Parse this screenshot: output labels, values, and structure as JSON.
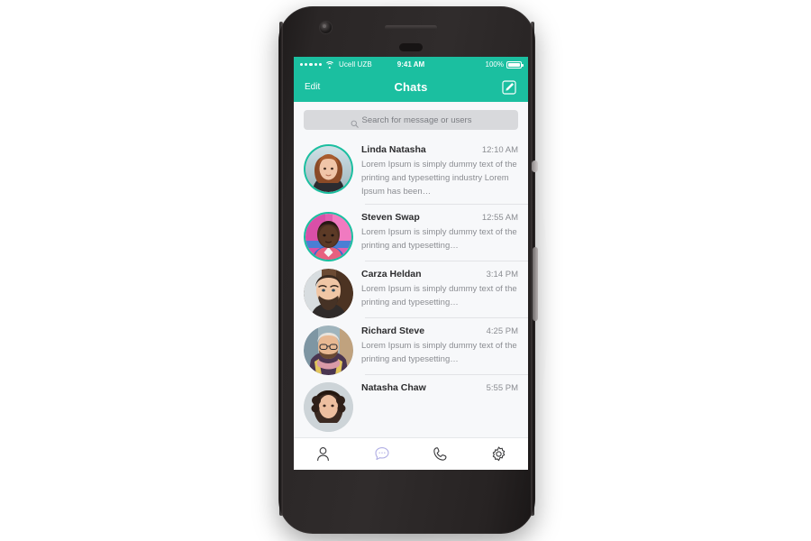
{
  "device": {
    "label": "smartphone-mockup",
    "camera_icon": "camera-icon",
    "speaker_icon": "speaker-grille",
    "sensor_icon": "proximity-sensor",
    "power_button": "power-button",
    "volume_button": "volume-button"
  },
  "theme": {
    "accent": "#1BBFA0",
    "screen_bg": "#F7F8FA",
    "tab_active": "#B0AEE4",
    "tab_inactive": "#3A3A3C",
    "name_color": "#2C2C2E",
    "muted_color": "#8B8D92",
    "divider": "#E2E3E6",
    "search_bg": "#D8D9DC"
  },
  "status_bar": {
    "signal_icon": "signal-dots-icon",
    "signal_bars": 5,
    "wifi_icon": "wifi-icon",
    "carrier": "Ucell UZB",
    "time": "9:41 AM",
    "battery_percent": "100%",
    "battery_icon": "battery-full-icon"
  },
  "nav_bar": {
    "edit_label": "Edit",
    "title": "Chats",
    "compose_icon": "compose-icon"
  },
  "search": {
    "icon": "search-icon",
    "placeholder": "Search for message or users",
    "value": ""
  },
  "chats": [
    {
      "name": "Linda Natasha",
      "time": "12:10 AM",
      "preview": "Lorem Ipsum is simply dummy text of the printing and typesetting industry Lorem Ipsum has been…",
      "avatar": "avatar-linda-natasha",
      "ring": true
    },
    {
      "name": "Steven Swap",
      "time": "12:55 AM",
      "preview": "Lorem Ipsum is simply dummy text of the printing and typesetting…",
      "avatar": "avatar-steven-swap",
      "ring": true
    },
    {
      "name": "Carza Heldan",
      "time": "3:14 PM",
      "preview": "Lorem Ipsum is simply dummy text of the printing and typesetting…",
      "avatar": "avatar-carza-heldan",
      "ring": false
    },
    {
      "name": "Richard Steve",
      "time": "4:25 PM",
      "preview": "Lorem Ipsum is simply dummy text of the printing and typesetting…",
      "avatar": "avatar-richard-steve",
      "ring": false
    },
    {
      "name": "Natasha Chaw",
      "time": "5:55 PM",
      "preview": "",
      "avatar": "avatar-natasha-chaw",
      "ring": false
    }
  ],
  "tab_bar": {
    "items": [
      {
        "icon": "person-icon",
        "name": "tab-contacts",
        "active": false
      },
      {
        "icon": "chat-bubble-icon",
        "name": "tab-chats",
        "active": true
      },
      {
        "icon": "phone-icon",
        "name": "tab-calls",
        "active": false
      },
      {
        "icon": "gear-icon",
        "name": "tab-settings",
        "active": false
      }
    ]
  }
}
